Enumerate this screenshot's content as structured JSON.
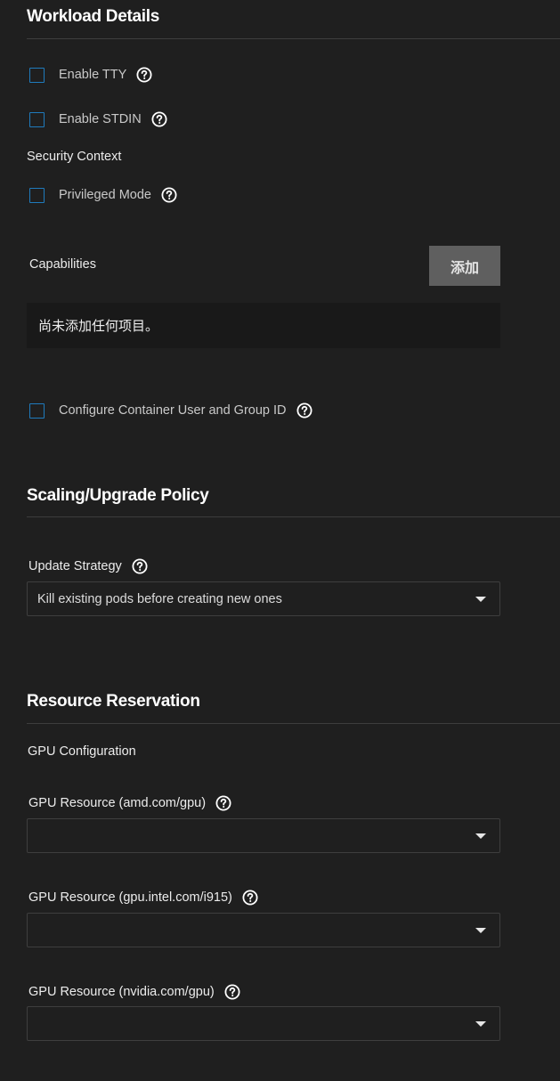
{
  "workload": {
    "title": "Workload Details",
    "enable_tty": "Enable TTY",
    "enable_stdin": "Enable STDIN",
    "security_context": "Security Context",
    "privileged_mode": "Privileged Mode",
    "capabilities_label": "Capabilities",
    "add_button": "添加",
    "empty_message": "尚未添加任何项目。",
    "configure_user_group": "Configure Container User and Group ID"
  },
  "scaling": {
    "title": "Scaling/Upgrade Policy",
    "update_strategy_label": "Update Strategy",
    "update_strategy_value": "Kill existing pods before creating new ones"
  },
  "resources": {
    "title": "Resource Reservation",
    "gpu_configuration": "GPU Configuration",
    "gpu_amd_label": "GPU Resource (amd.com/gpu)",
    "gpu_amd_value": "",
    "gpu_intel_label": "GPU Resource (gpu.intel.com/i915)",
    "gpu_intel_value": "",
    "gpu_nvidia_label": "GPU Resource (nvidia.com/gpu)",
    "gpu_nvidia_value": ""
  },
  "colors": {
    "background": "#1f1f1f",
    "checkbox_border": "#1f7bbd",
    "button_bg": "#5f5f5f",
    "empty_box_bg": "#191919"
  },
  "icons": {
    "help": "help-circle-icon",
    "dropdown": "chevron-down-icon"
  }
}
